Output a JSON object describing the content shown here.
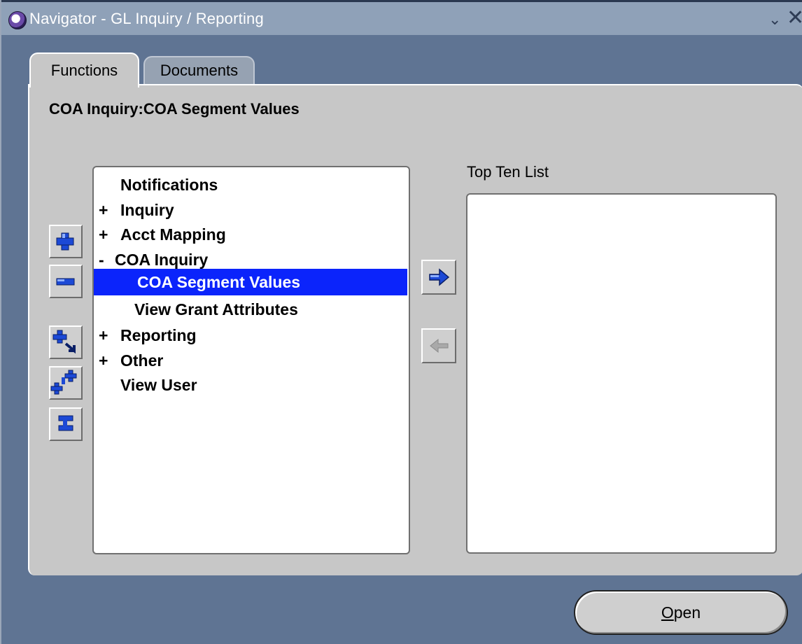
{
  "window": {
    "title": "Navigator - GL Inquiry / Reporting",
    "minimize_glyph": "⌄",
    "close_glyph": "✕"
  },
  "tabs": [
    {
      "label": "Functions",
      "active": true
    },
    {
      "label": "Documents",
      "active": false
    }
  ],
  "section_title": "COA Inquiry:COA Segment Values",
  "tree": [
    {
      "prefix": "",
      "label": "Notifications",
      "level": 0,
      "selected": false
    },
    {
      "prefix": "+",
      "label": "Inquiry",
      "level": 0,
      "selected": false
    },
    {
      "prefix": "+",
      "label": "Acct Mapping",
      "level": 0,
      "selected": false
    },
    {
      "prefix": "-",
      "label": "COA Inquiry",
      "level": 0,
      "selected": false
    },
    {
      "prefix": "",
      "label": "COA Segment Values",
      "level": 1,
      "selected": true
    },
    {
      "prefix": "",
      "label": "View Grant Attributes",
      "level": 1,
      "selected": false
    },
    {
      "prefix": "+",
      "label": "Reporting",
      "level": 0,
      "selected": false
    },
    {
      "prefix": "+",
      "label": "Other",
      "level": 0,
      "selected": false
    },
    {
      "prefix": "",
      "label": "View User",
      "level": 0,
      "selected": false
    }
  ],
  "side_buttons": [
    "expand-icon",
    "collapse-icon",
    "expand-branch-icon",
    "expand-all-icon",
    "collapse-all-icon"
  ],
  "arrow_buttons": [
    "add-to-list-icon",
    "remove-from-list-icon"
  ],
  "top_ten": {
    "label": "Top Ten List",
    "items": []
  },
  "open_button": {
    "mnemonic": "O",
    "rest": "pen"
  },
  "colors": {
    "selection": "#0b24fb",
    "background": "#5f7493",
    "panel": "#c7c7c7"
  }
}
